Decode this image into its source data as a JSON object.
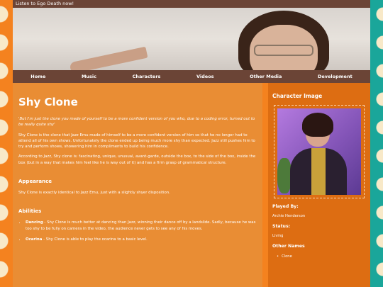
{
  "topbar": {
    "text": "Listen to Ego Death now!"
  },
  "nav": {
    "items": [
      "Home",
      "Music",
      "Characters",
      "Videos",
      "Other Media",
      "Development"
    ]
  },
  "main": {
    "title": "Shy Clone",
    "quote": "'But I'm just the clone you made of yourself to be a more confident version of you who, due to a coding error, turned out to be really quite shy'",
    "para1": "Shy Clone is the clone that Jazz Emu made of himself to be a more confident version of him so that he no longer had to attend all of his own shows. Unfortunately the clone ended up being much more shy than expected. Jazz still pushes him to try and perform shows, showering him in compliments to build his confidence.",
    "para2": "According to Jazz, Shy clone is: fascinating, unique, unusual, avant-garde, outside the box, to the side of the box, inside the box (but in a way that makes him feel like he is way out of it) and has a firm grasp of grammatical structure.",
    "appearance_heading": "Appearance",
    "appearance_text": "Shy Clone is exactly identical to Jazz Emu, just with a slightly shyer disposition.",
    "abilities_heading": "Abilities",
    "abilities": [
      {
        "name": "Dancing",
        "text": " - Shy Clone is much better at dancing than Jazz, winning their dance off by a landslide. Sadly, because he was too shy to be fully on camera in the video, the audience never gets to see any of his moves."
      },
      {
        "name": "Ocarina",
        "text": " - Shy Clone is able to play the ocarina to a basic level."
      }
    ]
  },
  "side": {
    "image_heading": "Character Image",
    "played_by_label": "Played By:",
    "played_by": "Archie Henderson",
    "status_label": "Status:",
    "status": "Living",
    "other_names_label": "Other Names",
    "other_names": [
      "Clone"
    ]
  }
}
